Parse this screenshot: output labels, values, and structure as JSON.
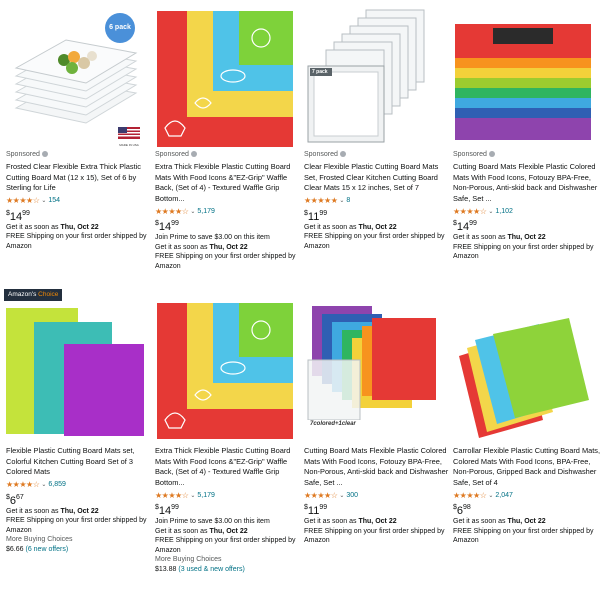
{
  "products": [
    {
      "sponsored": "Sponsored",
      "title": "Frosted Clear Flexible Extra Thick Plastic Cutting Board Mat (12 x 15), Set of 6 by Sterling for Life",
      "stars": "★★★★☆",
      "rating_count": "154",
      "price_symbol": "$",
      "price_whole": "14",
      "price_fraction": "99",
      "lines": [
        "Get it as soon as |Thu, Oct 22",
        "FREE Shipping on your first order shipped by Amazon"
      ],
      "image_badge": "6 pack",
      "image_flag": "MADE IN USA"
    },
    {
      "sponsored": "Sponsored",
      "title": "Extra Thick Flexible Plastic Cutting Board Mats With Food Icons &\"EZ-Grip\" Waffle Back, (Set of 4) - Textured Waffle Grip Bottom...",
      "stars": "★★★★☆",
      "rating_count": "5,179",
      "price_symbol": "$",
      "price_whole": "14",
      "price_fraction": "99",
      "lines": [
        "Join Prime to save $3.00 on this item",
        "Get it as soon as |Thu, Oct 22",
        "FREE Shipping on your first order shipped by Amazon"
      ]
    },
    {
      "sponsored": "Sponsored",
      "title": "Clear Flexible Plastic Cutting Board Mats Set, Frosted Clear Kitchen Cutting Board Clear Mats 15 x 12 inches, Set of 7",
      "stars": "★★★★★",
      "rating_count": "8",
      "price_symbol": "$",
      "price_whole": "11",
      "price_fraction": "99",
      "lines": [
        "Get it as soon as |Thu, Oct 22",
        "FREE Shipping on your first order shipped by Amazon"
      ],
      "image_label": "7 pack"
    },
    {
      "sponsored": "Sponsored",
      "title": "Cutting Board Mats Flexible Plastic Colored Mats With Food Icons, Fotouzy BPA-Free, Non-Porous, Anti-skid back and Dishwasher Safe, Set ...",
      "stars": "★★★★☆",
      "rating_count": "1,102",
      "price_symbol": "$",
      "price_whole": "14",
      "price_fraction": "99",
      "lines": [
        "Get it as soon as |Thu, Oct 22",
        "FREE Shipping on your first order shipped by Amazon"
      ]
    },
    {
      "title": "Flexible Plastic Cutting Board Mats set, Colorful Kitchen Cutting Board Set of 3 Colored Mats",
      "stars": "★★★★☆",
      "rating_count": "6,859",
      "price_symbol": "$",
      "price_whole": "6",
      "price_fraction": "67",
      "lines": [
        "Get it as soon as |Thu, Oct 22",
        "FREE Shipping on your first order shipped by Amazon"
      ],
      "more_label": "More Buying Choices",
      "more_price": "$6.66",
      "more_link": "(6 new offers)",
      "badge_prefix": "Amazon's",
      "badge_accent": "Choice"
    },
    {
      "title": "Extra Thick Flexible Plastic Cutting Board Mats With Food Icons &\"EZ-Grip\" Waffle Back, (Set of 4) - Textured Waffle Grip Bottom...",
      "stars": "★★★★☆",
      "rating_count": "5,179",
      "price_symbol": "$",
      "price_whole": "14",
      "price_fraction": "99",
      "lines": [
        "Join Prime to save $3.00 on this item",
        "Get it as soon as |Thu, Oct 22",
        "FREE Shipping on your first order shipped by Amazon"
      ],
      "more_label": "More Buying Choices",
      "more_price": "$13.88",
      "more_link": "(3 used & new offers)"
    },
    {
      "title": "Cutting Board Mats Flexible Plastic Colored Mats With Food Icons, Fotouzy BPA-Free, Non-Porous, Anti-skid back and Dishwasher Safe, Set ...",
      "stars": "★★★★☆",
      "rating_count": "300",
      "price_symbol": "$",
      "price_whole": "11",
      "price_fraction": "99",
      "lines": [
        "Get it as soon as |Thu, Oct 22",
        "FREE Shipping on your first order shipped by Amazon"
      ],
      "image_label": "7colored+1clear"
    },
    {
      "title": "Carrollar Flexible Plastic Cutting Board Mats, Colored Mats With Food Icons, BPA-Free, Non-Porous, Gripped Back and Dishwasher Safe, Set of 4",
      "stars": "★★★★☆",
      "rating_count": "2,047",
      "price_symbol": "$",
      "price_whole": "6",
      "price_fraction": "98",
      "lines": [
        "Get it as soon as |Thu, Oct 22",
        "FREE Shipping on your first order shipped by Amazon"
      ]
    }
  ],
  "colors": {
    "star": "#de7921",
    "link": "#007185",
    "badge_bg": "#232f3e",
    "badge_accent": "#f08804",
    "red": "#e53935",
    "yellow": "#f3d64a",
    "blue": "#4fc3e8",
    "green": "#7ed23a",
    "purple": "#9b3fbf",
    "orange": "#f7931e"
  }
}
